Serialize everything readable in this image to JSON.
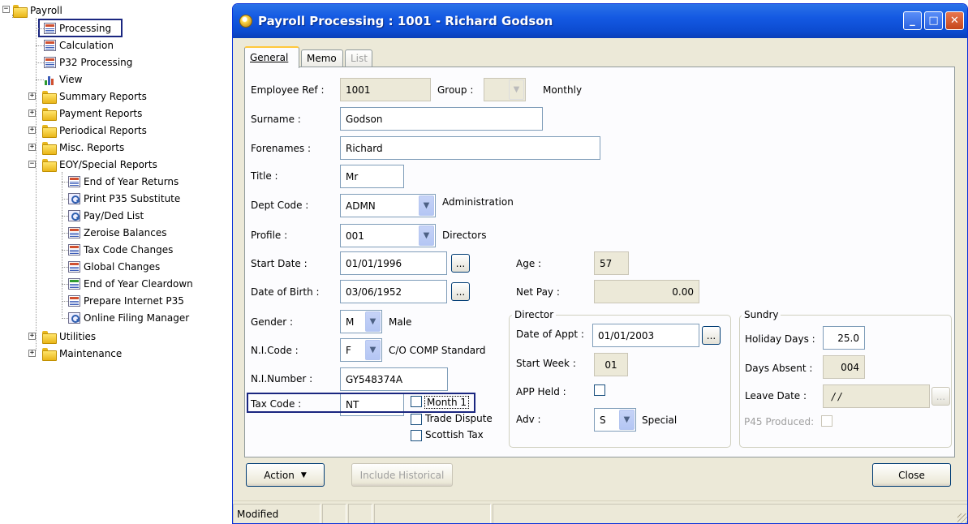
{
  "tree": {
    "root": "Payroll",
    "items": [
      {
        "label": "Processing",
        "icon": "doc"
      },
      {
        "label": "Calculation",
        "icon": "doc"
      },
      {
        "label": "P32 Processing",
        "icon": "doc"
      },
      {
        "label": "View",
        "icon": "chart"
      },
      {
        "label": "Summary Reports",
        "icon": "folder"
      },
      {
        "label": "Payment Reports",
        "icon": "folder"
      },
      {
        "label": "Periodical Reports",
        "icon": "folder"
      },
      {
        "label": "Misc. Reports",
        "icon": "folder"
      },
      {
        "label": "EOY/Special Reports",
        "icon": "folder"
      },
      {
        "label": "End of Year Returns",
        "icon": "doc"
      },
      {
        "label": "Print P35 Substitute",
        "icon": "mag"
      },
      {
        "label": "Pay/Ded List",
        "icon": "mag"
      },
      {
        "label": "Zeroise Balances",
        "icon": "doc"
      },
      {
        "label": "Tax Code Changes",
        "icon": "doc"
      },
      {
        "label": "Global Changes",
        "icon": "doc"
      },
      {
        "label": "End of Year Cleardown",
        "icon": "doc-green"
      },
      {
        "label": "Prepare Internet P35",
        "icon": "doc"
      },
      {
        "label": "Online Filing Manager",
        "icon": "mag"
      },
      {
        "label": "Utilities",
        "icon": "folder"
      },
      {
        "label": "Maintenance",
        "icon": "folder"
      }
    ]
  },
  "window": {
    "title": "Payroll Processing : 1001 - Richard Godson",
    "controls": {
      "minimize": "_",
      "maximize": "□",
      "close": "✕"
    }
  },
  "tabs": [
    "General",
    "Memo",
    "List"
  ],
  "form": {
    "employee_ref_label": "Employee Ref :",
    "employee_ref": "1001",
    "group_label": "Group :",
    "group_value": "",
    "group_desc": "Monthly",
    "surname_label": "Surname :",
    "surname": "Godson",
    "forenames_label": "Forenames :",
    "forenames": "Richard",
    "title_label": "Title :",
    "title": "Mr",
    "dept_label": "Dept Code :",
    "dept": "ADMN",
    "dept_desc": "Administration",
    "profile_label": "Profile :",
    "profile": "001",
    "profile_desc": "Directors",
    "start_date_label": "Start Date :",
    "start_date": "01/01/1996",
    "dob_label": "Date of Birth :",
    "dob": "03/06/1952",
    "age_label": "Age :",
    "age": "57",
    "net_pay_label": "Net Pay :",
    "net_pay": "0.00",
    "gender_label": "Gender :",
    "gender": "M",
    "gender_desc": "Male",
    "ni_code_label": "N.I.Code :",
    "ni_code": "F",
    "ni_code_desc": "C/O COMP Standard",
    "ni_number_label": "N.I.Number :",
    "ni_number": "GY548374A",
    "tax_code_label": "Tax Code :",
    "tax_code": "NT",
    "month1_label": "Month 1",
    "trade_dispute_label": "Trade Dispute",
    "scottish_tax_label": "Scottish Tax",
    "ellipsis": "...",
    "director": {
      "title": "Director",
      "date_appt_label": "Date of Appt :",
      "date_appt": "01/01/2003",
      "start_week_label": "Start Week :",
      "start_week": "01",
      "app_held_label": "APP Held :",
      "adv_label": "Adv :",
      "adv": "S",
      "adv_desc": "Special"
    },
    "sundry": {
      "title": "Sundry",
      "holiday_days_label": "Holiday Days :",
      "holiday_days": "25.0",
      "days_absent_label": "Days Absent :",
      "days_absent": "004",
      "leave_date_label": "Leave Date :",
      "leave_date": "/ /",
      "p45_label": "P45 Produced:"
    }
  },
  "buttons": {
    "action": "Action",
    "include_historical": "Include Historical",
    "close": "Close"
  },
  "status": {
    "text": "Modified"
  }
}
